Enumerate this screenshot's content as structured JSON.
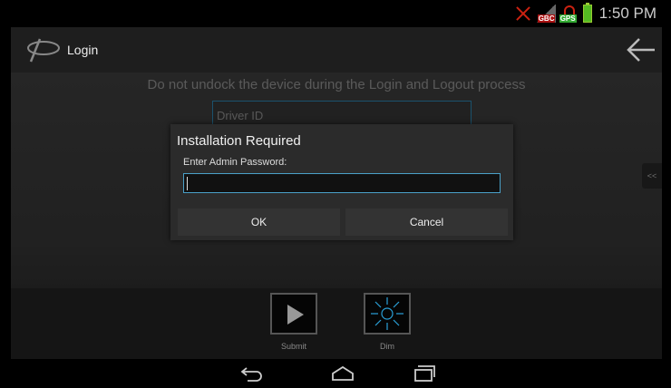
{
  "status_bar": {
    "time": "1:50 PM",
    "icons": [
      "no-connection-icon",
      "no-signal-icon",
      "gps-off-icon",
      "battery-charging-icon"
    ],
    "signal_badge": "GBC",
    "gps_badge": "GPS",
    "accent_colors": {
      "alert": "#cc2211",
      "battery": "#55bb22"
    }
  },
  "header": {
    "title": "Login",
    "logo": "app-logo",
    "back_icon": "back-arrow-icon"
  },
  "main": {
    "notice": "Do not undock the device during the Login and Logout process",
    "driver_id_placeholder": "Driver ID",
    "side_tab": "<<"
  },
  "dialog": {
    "title": "Installation Required",
    "label": "Enter Admin Password:",
    "password_value": "",
    "ok_label": "OK",
    "cancel_label": "Cancel",
    "accent": "#4aa0c8"
  },
  "toolbar": {
    "submit_label": "Submit",
    "dim_label": "Dim"
  },
  "navbar": {
    "icons": [
      "back-icon",
      "home-icon",
      "recent-apps-icon"
    ]
  }
}
